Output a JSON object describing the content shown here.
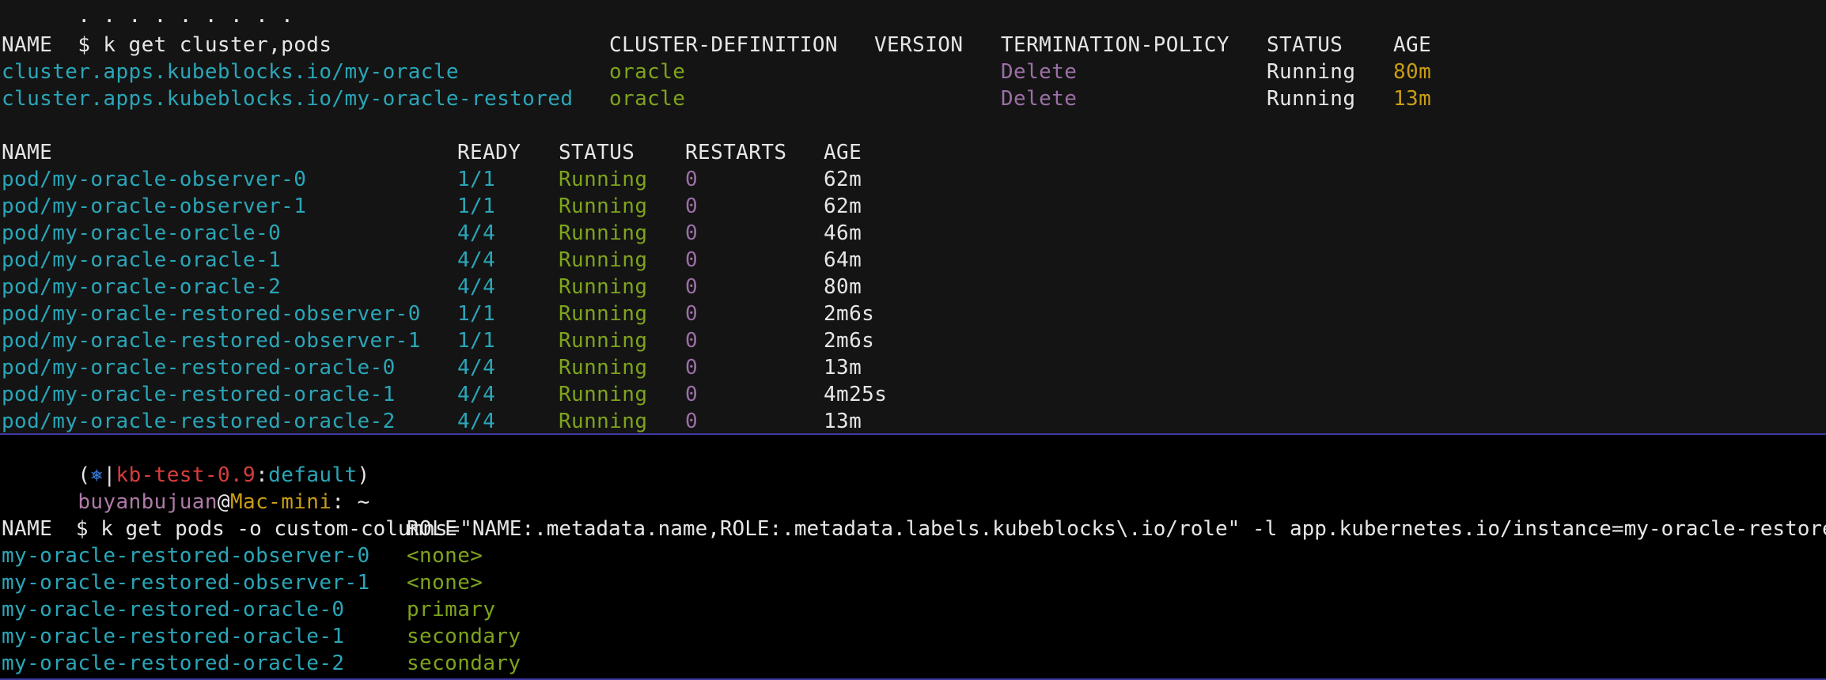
{
  "top_pane": {
    "prev_line": "· · · · · · · · ·",
    "cmd1": "$ k get cluster,pods",
    "cluster_headers": [
      "NAME",
      "CLUSTER-DEFINITION",
      "VERSION",
      "TERMINATION-POLICY",
      "STATUS",
      "AGE"
    ],
    "clusters": [
      {
        "name": "cluster.apps.kubeblocks.io/my-oracle",
        "def": "oracle",
        "version": "",
        "policy": "Delete",
        "status": "Running",
        "age": "80m"
      },
      {
        "name": "cluster.apps.kubeblocks.io/my-oracle-restored",
        "def": "oracle",
        "version": "",
        "policy": "Delete",
        "status": "Running",
        "age": "13m"
      }
    ],
    "pod_headers": [
      "NAME",
      "READY",
      "STATUS",
      "RESTARTS",
      "AGE"
    ],
    "pods": [
      {
        "name": "pod/my-oracle-observer-0",
        "ready": "1/1",
        "status": "Running",
        "restarts": "0",
        "age": "62m"
      },
      {
        "name": "pod/my-oracle-observer-1",
        "ready": "1/1",
        "status": "Running",
        "restarts": "0",
        "age": "62m"
      },
      {
        "name": "pod/my-oracle-oracle-0",
        "ready": "4/4",
        "status": "Running",
        "restarts": "0",
        "age": "46m"
      },
      {
        "name": "pod/my-oracle-oracle-1",
        "ready": "4/4",
        "status": "Running",
        "restarts": "0",
        "age": "64m"
      },
      {
        "name": "pod/my-oracle-oracle-2",
        "ready": "4/4",
        "status": "Running",
        "restarts": "0",
        "age": "80m"
      },
      {
        "name": "pod/my-oracle-restored-observer-0",
        "ready": "1/1",
        "status": "Running",
        "restarts": "0",
        "age": "2m6s"
      },
      {
        "name": "pod/my-oracle-restored-observer-1",
        "ready": "1/1",
        "status": "Running",
        "restarts": "0",
        "age": "2m6s"
      },
      {
        "name": "pod/my-oracle-restored-oracle-0",
        "ready": "4/4",
        "status": "Running",
        "restarts": "0",
        "age": "13m"
      },
      {
        "name": "pod/my-oracle-restored-oracle-1",
        "ready": "4/4",
        "status": "Running",
        "restarts": "0",
        "age": "4m25s"
      },
      {
        "name": "pod/my-oracle-restored-oracle-2",
        "ready": "4/4",
        "status": "Running",
        "restarts": "0",
        "age": "13m"
      }
    ]
  },
  "bottom_pane": {
    "k8s_context": {
      "open": "(",
      "icon": "⎈",
      "sep": "|",
      "cluster": "kb-test-0.9",
      "colon": ":",
      "namespace": "default",
      "close": ")"
    },
    "prompt": {
      "user": "buyanbujuan",
      "at": "@",
      "host": "Mac-mini",
      "path": ": ~"
    },
    "cmd2": "$ k get pods -o custom-columns=\"NAME:.metadata.name,ROLE:.metadata.labels.kubeblocks\\.io/role\" -l app.kubernetes.io/instance=my-oracle-restored",
    "role_headers": [
      "NAME",
      "ROLE"
    ],
    "roles": [
      {
        "name": "my-oracle-restored-observer-0",
        "role": "<none>"
      },
      {
        "name": "my-oracle-restored-observer-1",
        "role": "<none>"
      },
      {
        "name": "my-oracle-restored-oracle-0",
        "role": "primary"
      },
      {
        "name": "my-oracle-restored-oracle-1",
        "role": "secondary"
      },
      {
        "name": "my-oracle-restored-oracle-2",
        "role": "secondary"
      }
    ]
  },
  "colors": {
    "cyan": "#2aa6b8",
    "green": "#7ea41c",
    "purple": "#9b6fa6",
    "yellow": "#c99d16",
    "red": "#d63d3d",
    "divider": "#3d3aa3"
  }
}
